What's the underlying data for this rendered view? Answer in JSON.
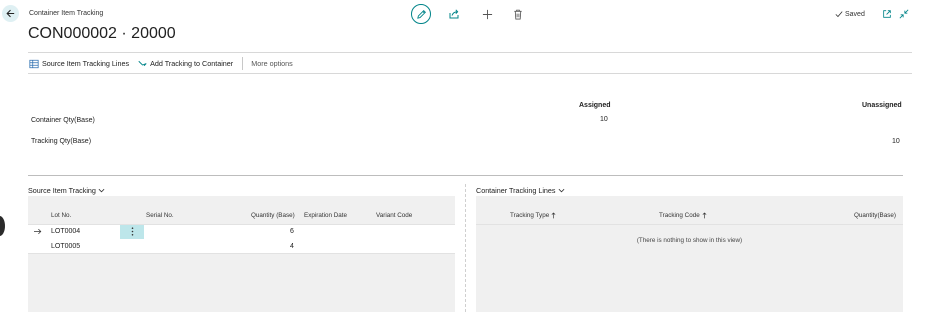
{
  "header": {
    "caption": "Container Item Tracking",
    "title": "CON000002 · 20000",
    "status": "Saved"
  },
  "actions": {
    "source_lines": "Source Item Tracking Lines",
    "add_tracking": "Add Tracking to Container",
    "more": "More options"
  },
  "summary": {
    "assigned_header": "Assigned",
    "unassigned_header": "Unassigned",
    "rows": [
      {
        "label": "Container Qty(Base)",
        "assigned": "10",
        "unassigned": ""
      },
      {
        "label": "Tracking Qty(Base)",
        "assigned": "",
        "unassigned": "10"
      }
    ]
  },
  "source_tracking": {
    "title": "Source Item Tracking",
    "columns": {
      "lot": "Lot No.",
      "serial": "Serial No.",
      "qty": "Quantity (Base)",
      "expiration": "Expiration Date",
      "variant": "Variant Code"
    },
    "rows": [
      {
        "lot": "LOT0004",
        "serial": "",
        "qty": "6",
        "expiration": "",
        "variant": ""
      },
      {
        "lot": "LOT0005",
        "serial": "",
        "qty": "4",
        "expiration": "",
        "variant": ""
      }
    ]
  },
  "container_tracking": {
    "title": "Container Tracking Lines",
    "columns": {
      "type": "Tracking Type",
      "code": "Tracking Code",
      "qty": "Quantity(Base)"
    },
    "empty": "(There is nothing to show in this view)"
  },
  "colors": {
    "accent": "#008489",
    "selected_cell": "#bde6ea"
  }
}
